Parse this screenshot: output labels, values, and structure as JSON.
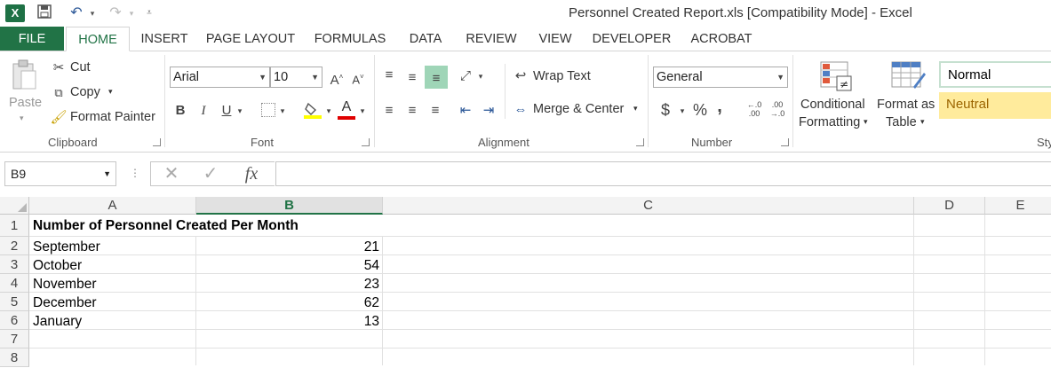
{
  "window": {
    "title": "Personnel Created Report.xls  [Compatibility Mode] - Excel"
  },
  "qat": {
    "logo": "X",
    "icons": [
      "save-icon",
      "undo-icon",
      "redo-icon",
      "customize-icon"
    ]
  },
  "tabs": [
    "FILE",
    "HOME",
    "INSERT",
    "PAGE LAYOUT",
    "FORMULAS",
    "DATA",
    "REVIEW",
    "VIEW",
    "DEVELOPER",
    "ACROBAT"
  ],
  "ribbon": {
    "clipboard": {
      "paste": "Paste",
      "cut": "Cut",
      "copy": "Copy",
      "format_painter": "Format Painter",
      "label": "Clipboard"
    },
    "font": {
      "name": "Arial",
      "size": "10",
      "bold": "B",
      "italic": "I",
      "underline": "U",
      "label": "Font"
    },
    "alignment": {
      "wrap": "Wrap Text",
      "merge": "Merge & Center",
      "label": "Alignment"
    },
    "number": {
      "format": "General",
      "currency": "$",
      "percent": "%",
      "comma": ",",
      "label": "Number"
    },
    "styles": {
      "conditional_1": "Conditional",
      "conditional_2": "Formatting",
      "table_1": "Format as",
      "table_2": "Table",
      "normal": "Normal",
      "neutral": "Neutral",
      "label": "Sty",
      "neutral_bg": "#ffeb9c",
      "neutral_fg": "#9c6500"
    }
  },
  "formula_bar": {
    "name_box": "B9",
    "fx": "fx",
    "value": ""
  },
  "sheet": {
    "columns": [
      "A",
      "B",
      "C",
      "D",
      "E"
    ],
    "selected_column": "B",
    "rows": [
      "1",
      "2",
      "3",
      "4",
      "5",
      "6",
      "7",
      "8"
    ],
    "title": "Number of Personnel Created Per Month",
    "data": [
      {
        "month": "September",
        "count": "21"
      },
      {
        "month": "October",
        "count": "54"
      },
      {
        "month": "November",
        "count": "23"
      },
      {
        "month": "December",
        "count": "62"
      },
      {
        "month": "January",
        "count": "13"
      }
    ]
  },
  "accent": "#217346"
}
